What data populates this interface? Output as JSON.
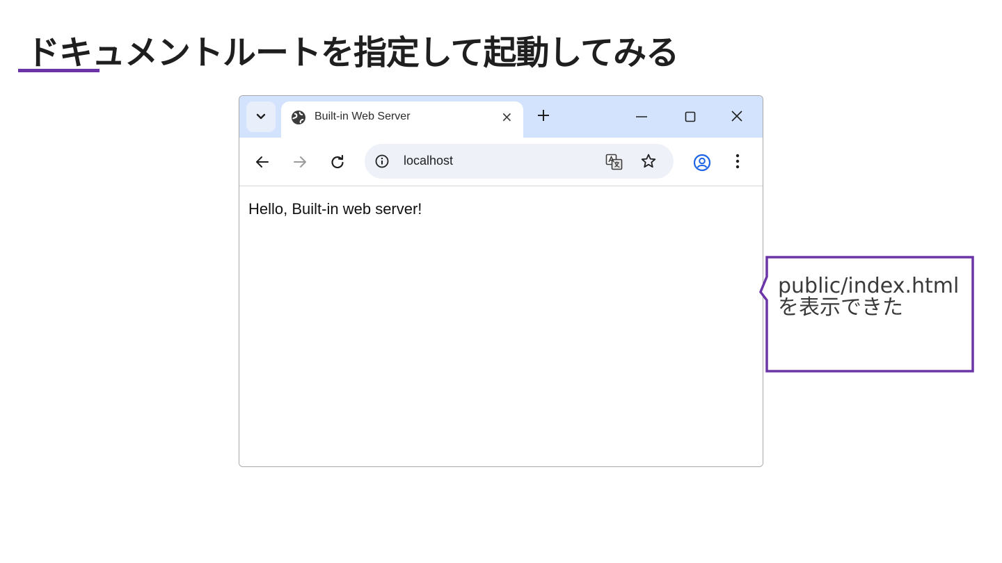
{
  "slide": {
    "title": "ドキュメントルートを指定して起動してみる",
    "accent_color": "#6b35a8"
  },
  "browser": {
    "tab_title": "Built-in Web Server",
    "tab_close_glyph": "×",
    "url": "localhost",
    "page_text": "Hello, Built-in web server!",
    "tabstrip_color": "#d3e3fd",
    "icons": {
      "tab_search": "chevron-down-icon",
      "favicon": "globe-icon",
      "new_tab": "plus-icon",
      "minimize": "minimize-icon",
      "maximize": "maximize-icon",
      "close": "close-icon",
      "back": "arrow-left-icon",
      "forward": "arrow-right-icon",
      "reload": "reload-icon",
      "site_info": "info-icon",
      "translate": "translate-icon",
      "bookmark": "star-icon",
      "profile": "profile-icon",
      "menu": "kebab-menu-icon"
    }
  },
  "callout": {
    "text": "public/index.htmlを表示できた",
    "border_color": "#6b35a8"
  }
}
